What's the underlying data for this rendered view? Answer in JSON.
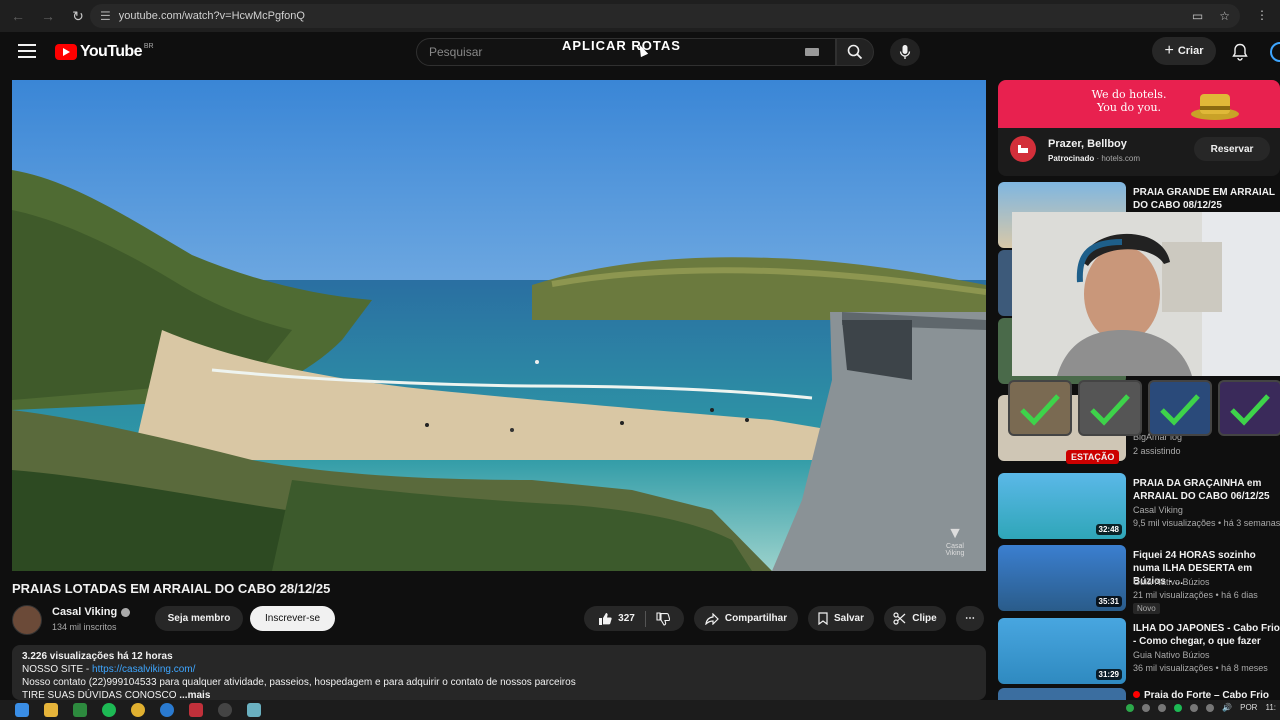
{
  "browser": {
    "url": "youtube.com/watch?v=HcwMcPgfonQ"
  },
  "header": {
    "logo_text": "YouTube",
    "country": "BR",
    "search_placeholder": "Pesquisar",
    "overlay_text": "APLICAR ROTAS",
    "create_label": "Criar"
  },
  "video": {
    "title": "PRAIAS LOTADAS EM ARRAIAL DO CABO 28/12/25",
    "watermark": "Casal Viking",
    "channel": {
      "name": "Casal Viking",
      "subs": "134 mil inscritos",
      "member_label": "Seja membro",
      "subscribe_label": "Inscrever-se"
    },
    "actions": {
      "likes": "327",
      "share_label": "Compartilhar",
      "save_label": "Salvar",
      "clip_label": "Clipe"
    },
    "description": {
      "stats": "3.226 visualizações  há 12 horas",
      "site_prefix": "NOSSO SITE - ",
      "site_link": "https://casalviking.com/",
      "contact": "Nosso contato (22)999104533 para qualquer atividade, passeios, hospedagem e para adquirir o contato de nossos parceiros",
      "truncated": "TIRE SUAS DÚVIDAS CONOSCO",
      "more": "...mais"
    }
  },
  "sidebar": {
    "ad": {
      "slogan": "We do hotels. You do you.",
      "title": "Prazer, Bellboy",
      "sponsored": "Patrocinado",
      "domain": "hotels.com",
      "button": "Reservar"
    },
    "partial": {
      "channel": "BigAmar log",
      "watching": "2 assistindo",
      "live_label": "ESTAÇÃO"
    },
    "items": [
      {
        "title": "PRAIA GRANDE EM ARRAIAL DO CABO 08/12/25",
        "channel": "",
        "meta": "",
        "duration": ""
      },
      {
        "title": "PRAIA DA GRAÇAINHA em ARRAIAL DO CABO 06/12/25",
        "channel": "Casal Viking",
        "meta": "9,5 mil visualizações • há 3 semanas",
        "duration": "32:48"
      },
      {
        "title": "Fiquei 24 HORAS sozinho numa ILHA DESERTA em Búzios - ...",
        "channel": "Guia Nativo Búzios",
        "meta": "21 mil visualizações • há 6 dias",
        "duration": "35:31",
        "badge": "Novo"
      },
      {
        "title": "ILHA DO JAPONES - Cabo Frio - Como chegar, o que fazer",
        "channel": "Guia Nativo Búzios",
        "meta": "36 mil visualizações • há 8 meses",
        "duration": "31:29"
      },
      {
        "title": "Praia do Forte – Cabo Frio",
        "channel": "",
        "meta": "",
        "duration": ""
      }
    ]
  },
  "taskbar": {
    "lang": "POR",
    "time": "11:"
  },
  "colors": {
    "accent_red": "#ff0000",
    "link_blue": "#3ea6ff",
    "ad_pink": "#e8214f"
  }
}
